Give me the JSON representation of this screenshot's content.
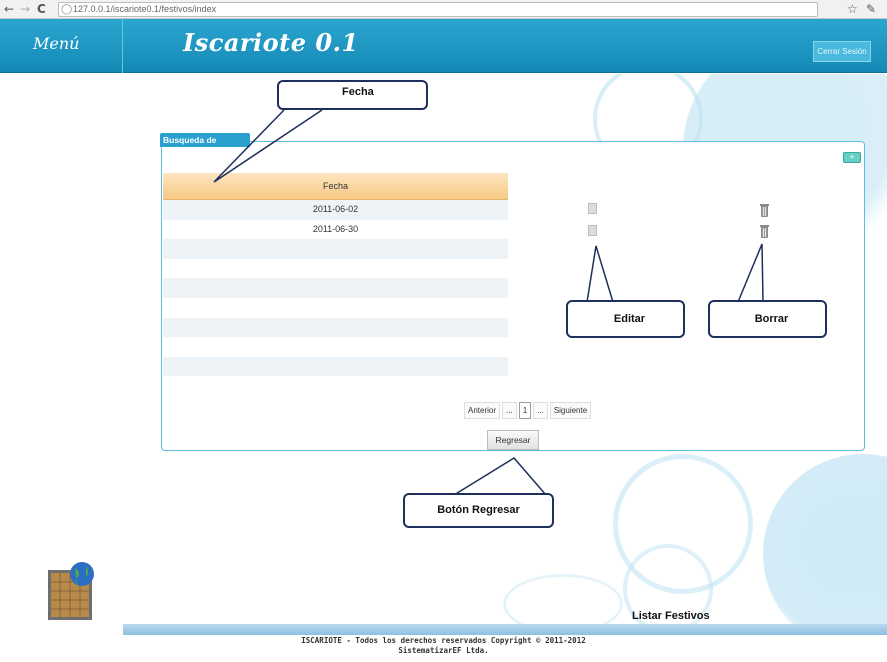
{
  "browser": {
    "url": "127.0.0.1/iscariote0.1/festivos/index"
  },
  "header": {
    "menu_label": "Menú",
    "app_title": "Iscariote 0.1",
    "logout_label": "Cerrar Sesión"
  },
  "panel": {
    "title": "Busqueda de Festivos",
    "add_label": "+"
  },
  "table": {
    "header": "Fecha",
    "rows": [
      "2011-06-02",
      "2011-06-30"
    ]
  },
  "pagination": {
    "prev": "Anterior",
    "ellipsis_left": "...",
    "current": "1",
    "ellipsis_right": "...",
    "next": "Siguiente"
  },
  "back_button": "Regresar",
  "callouts": {
    "fecha": "Fecha",
    "editar": "Editar",
    "borrar": "Borrar",
    "regresar": "Botón Regresar"
  },
  "page_label": "Listar Festivos",
  "footer": {
    "line1": "ISCARIOTE - Todos los derechos reservados Copyright © 2011-2012",
    "line2": "SistematizarEF Ltda."
  },
  "colors": {
    "header_blue": "#1a94c2",
    "table_header_orange": "#f6c986",
    "panel_border": "#5cbfdf"
  }
}
